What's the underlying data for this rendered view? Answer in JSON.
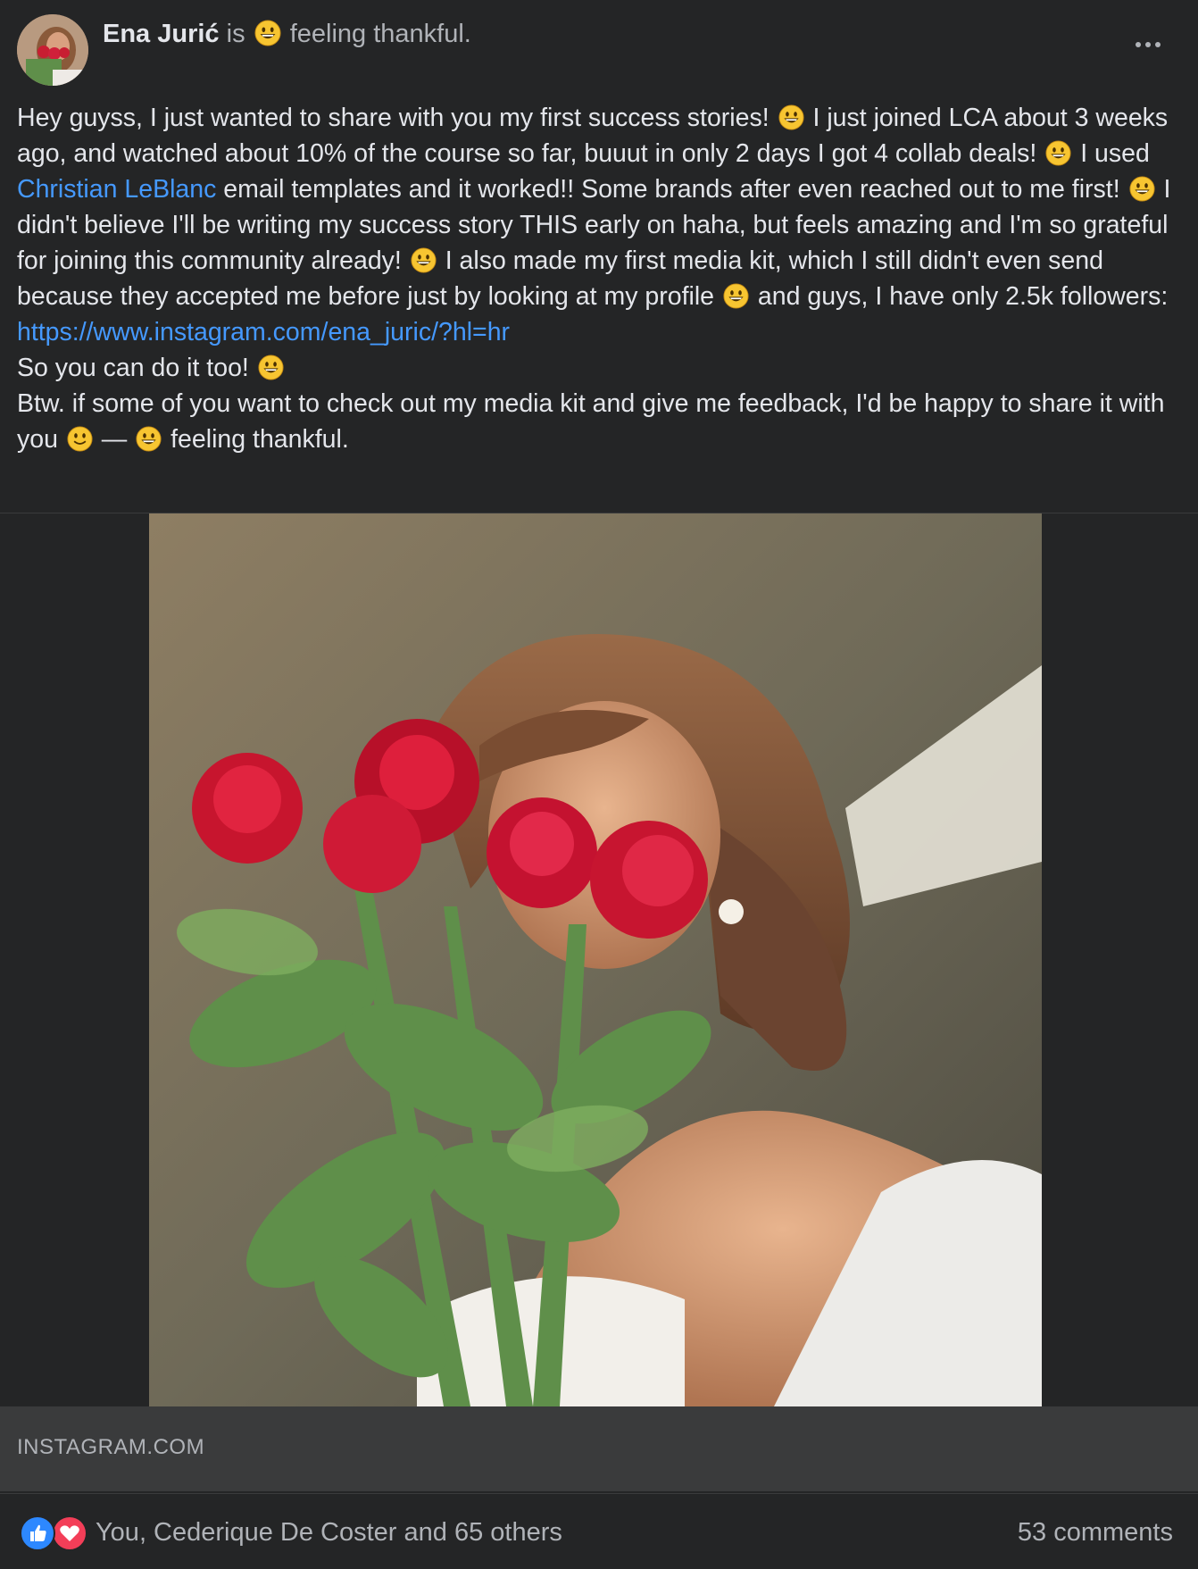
{
  "post": {
    "author_name": "Ena Jurić",
    "feeling_prefix": "is",
    "feeling_text": "feeling thankful.",
    "body": {
      "p1_a": "Hey guyss, I just wanted to share with you my first success stories!",
      "p1_b": "I just joined LCA about 3 weeks ago, and watched about 10% of the course so far, buuut in only 2 days I got 4 collab deals!",
      "p1_c": "I used",
      "mention": "Christian LeBlanc",
      "p1_d": "email templates and it worked!! Some brands after even reached out to me first!",
      "p1_e": "I didn't believe I'll be writing my success story THIS early on haha, but feels amazing and I'm so grateful for joining this community already!",
      "p1_f": "I also made my first media kit, which I still didn't even send because they accepted me before just by looking at my profile",
      "p1_g": "and guys, I have only 2.5k followers:",
      "url": "https://www.instagram.com/ena_juric/?hl=hr",
      "p2": "So you can do it too!",
      "p3": "Btw. if some of you want to check out my media kit and give me feedback, I'd be happy to share it with you",
      "p3_dash": "—",
      "p3_feeling": "feeling thankful."
    }
  },
  "link_preview": {
    "domain": "INSTAGRAM.COM"
  },
  "reactions": {
    "names": "You, Cederique De Coster and 65 others",
    "comments": "53 comments"
  },
  "icons": {
    "like": "like-icon",
    "love": "love-icon",
    "more": "more-options-icon",
    "emoji": "grinning-emoji-icon"
  },
  "colors": {
    "background": "#242526",
    "text": "#e4e6eb",
    "secondary_text": "#b0b3b8",
    "link": "#4599ff",
    "like": "#2d88ff",
    "love": "#f33e58"
  }
}
